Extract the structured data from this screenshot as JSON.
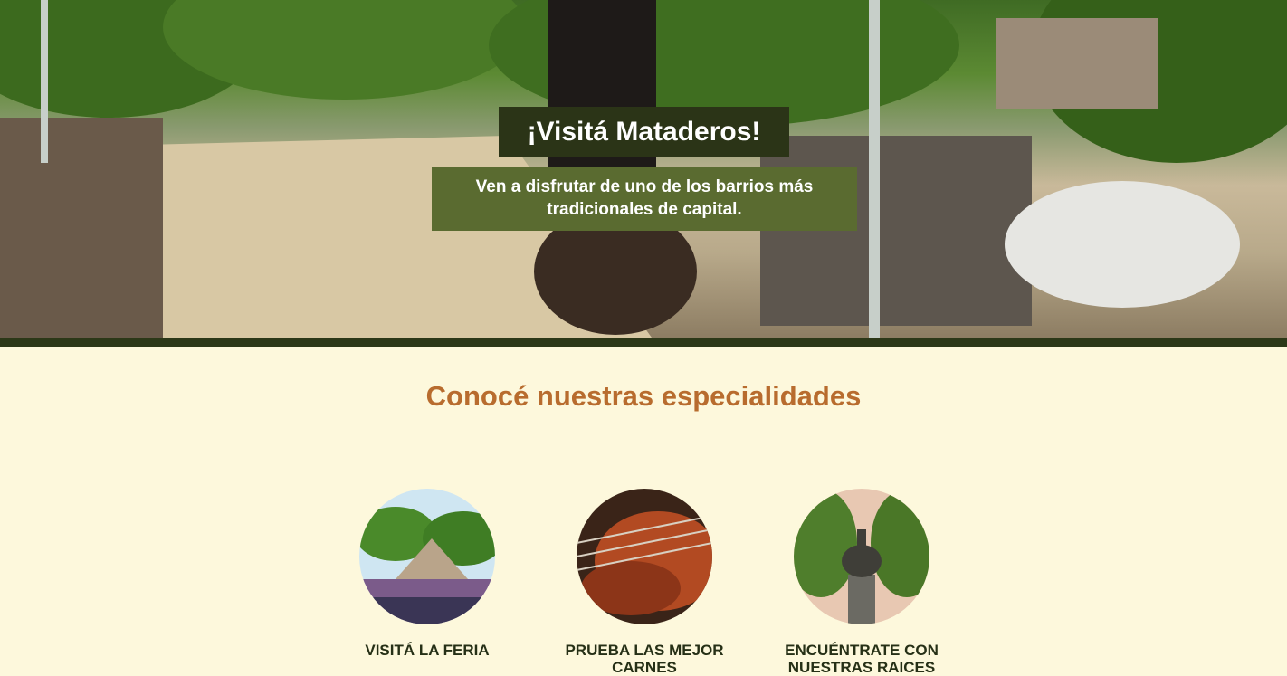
{
  "hero": {
    "title": "¡Visitá Mataderos!",
    "subtitle": "Ven a disfrutar de uno de los barrios más tradicionales de capital."
  },
  "specialties": {
    "heading": "Conocé nuestras especialidades",
    "cards": [
      {
        "label": "VISITÁ LA FERIA",
        "image": "fair-photo"
      },
      {
        "label": "PRUEBA LAS MEJOR CARNES",
        "image": "grilled-meat-photo"
      },
      {
        "label": "ENCUÉNTRATE CON NUESTRAS RAICES",
        "image": "statue-photo"
      }
    ]
  },
  "colors": {
    "page_bg": "#fdf8dc",
    "hero_title_bg": "#2b3417",
    "hero_sub_bg": "#5a6b30",
    "heading": "#b86c2e",
    "card_label": "#263016",
    "hero_bottom_bar": "#2c3818"
  }
}
